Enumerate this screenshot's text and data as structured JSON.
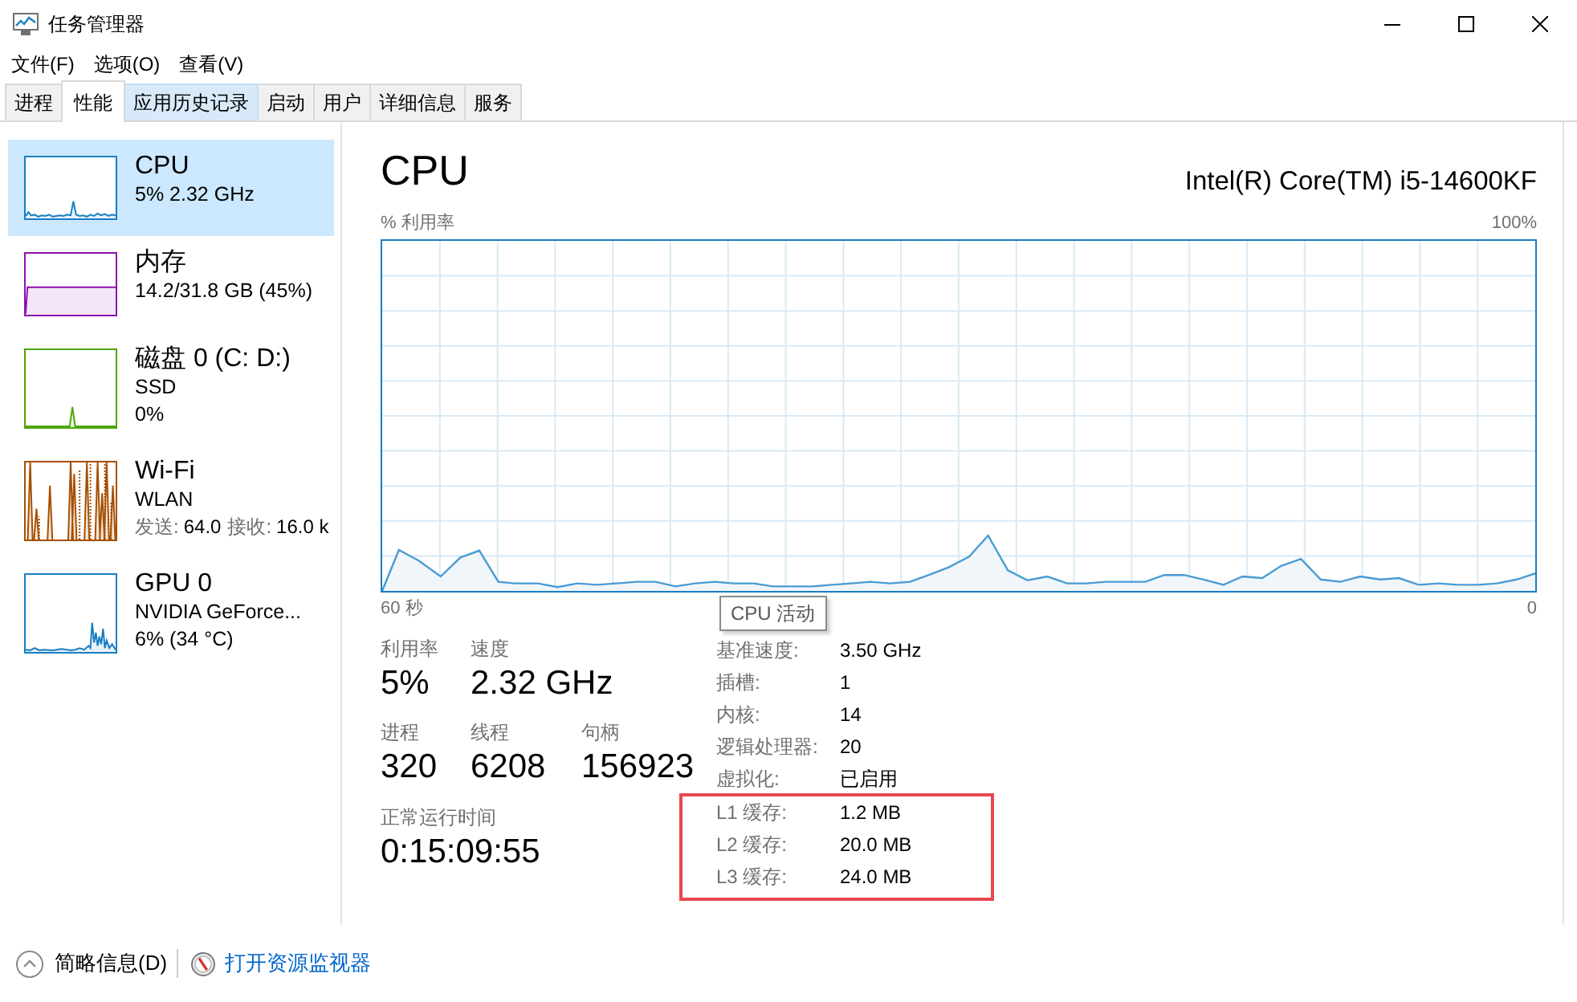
{
  "window": {
    "title": "任务管理器"
  },
  "menu": [
    "文件(F)",
    "选项(O)",
    "查看(V)"
  ],
  "tabs": [
    {
      "label": "进程",
      "selected": false,
      "hovered": false
    },
    {
      "label": "性能",
      "selected": true,
      "hovered": false
    },
    {
      "label": "应用历史记录",
      "selected": false,
      "hovered": true
    },
    {
      "label": "启动",
      "selected": false,
      "hovered": false
    },
    {
      "label": "用户",
      "selected": false,
      "hovered": false
    },
    {
      "label": "详细信息",
      "selected": false,
      "hovered": false
    },
    {
      "label": "服务",
      "selected": false,
      "hovered": false
    }
  ],
  "sidebar": {
    "items": [
      {
        "name": "CPU",
        "kind": "line",
        "color": "#1a7ec2",
        "selected": true,
        "details": [
          "5% 2.32 GHz"
        ]
      },
      {
        "name": "内存",
        "kind": "line",
        "color": "#8b12ae",
        "selected": false,
        "details": [
          "14.2/31.8 GB (45%)"
        ]
      },
      {
        "name": "磁盘 0 (C: D:)",
        "kind": "line",
        "color": "#4da60c",
        "selected": false,
        "details": [
          "SSD",
          "0%"
        ]
      },
      {
        "name": "Wi-Fi",
        "kind": "dual-line",
        "color": "#a74f01",
        "selected": false,
        "details": [
          "WLAN"
        ],
        "traffic": [
          {
            "label": "发送:",
            "value": "64.0"
          },
          {
            "label": "接收:",
            "value": "16.0 k"
          }
        ]
      },
      {
        "name": "GPU 0",
        "kind": "line",
        "color": "#1a7ec2",
        "selected": false,
        "details": [
          "NVIDIA GeForce...",
          "6% (34 °C)"
        ]
      }
    ]
  },
  "detail": {
    "title": "CPU",
    "model": "Intel(R) Core(TM) i5-14600KF",
    "y_axis_label": "% 利用率",
    "y_axis_max": "100%",
    "x_axis_start": "60 秒",
    "x_axis_end": "0",
    "tooltip": "CPU 活动",
    "stats": [
      [
        {
          "label": "利用率",
          "value": "5%"
        },
        {
          "label": "速度",
          "value": "2.32 GHz"
        }
      ],
      [
        {
          "label": "进程",
          "value": "320"
        },
        {
          "label": "线程",
          "value": "6208"
        },
        {
          "label": "句柄",
          "value": "156923"
        }
      ],
      [
        {
          "label": "正常运行时间",
          "value": "0:15:09:55"
        }
      ]
    ],
    "specs": [
      {
        "label": "基准速度:",
        "value": "3.50 GHz",
        "highlighted": false
      },
      {
        "label": "插槽:",
        "value": "1",
        "highlighted": false
      },
      {
        "label": "内核:",
        "value": "14",
        "highlighted": false
      },
      {
        "label": "逻辑处理器:",
        "value": "20",
        "highlighted": false
      },
      {
        "label": "虚拟化:",
        "value": "已启用",
        "highlighted": false
      },
      {
        "label": "L1 缓存:",
        "value": "1.2 MB",
        "highlighted": true
      },
      {
        "label": "L2 缓存:",
        "value": "20.0 MB",
        "highlighted": true
      },
      {
        "label": "L3 缓存:",
        "value": "24.0 MB",
        "highlighted": true
      }
    ]
  },
  "footer": {
    "toggle": "简略信息(D)",
    "link": "打开资源监视器"
  }
}
